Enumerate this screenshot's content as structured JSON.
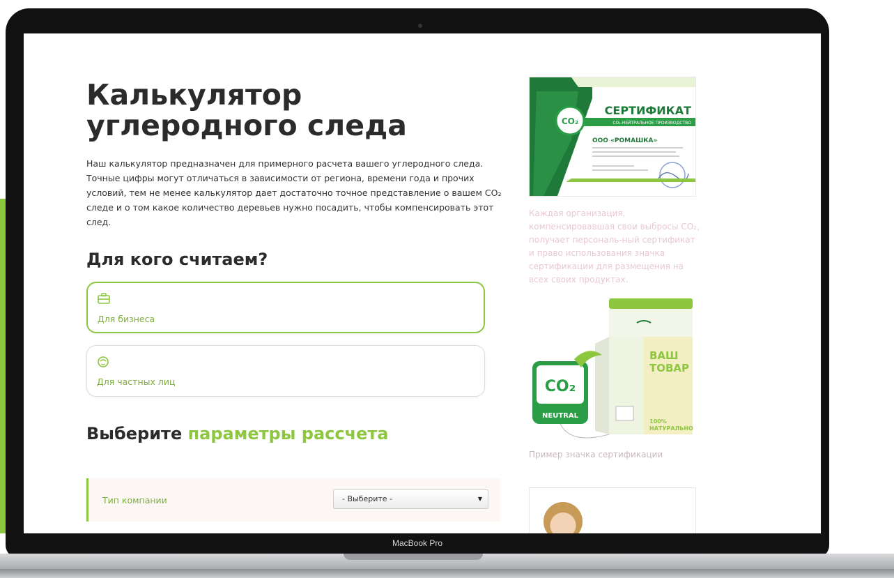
{
  "device": {
    "model_label": "MacBook Pro"
  },
  "page": {
    "title": "Калькулятор углеродного следа",
    "intro": "Наш калькулятор предназначен для примерного расчета вашего углеродного следа. Точные цифры могут отличаться в зависимости от региона, времени года и прочих условий, тем не менее калькулятор дает достаточно точное представление о вашем CO₂ следе и о том какое количество деревьев нужно посадить, чтобы компенсировать этот след.",
    "audience_heading": "Для кого считаем?",
    "audience_options": [
      {
        "label": "Для бизнеса",
        "icon": "briefcase-icon",
        "selected": true
      },
      {
        "label": "Для частных лиц",
        "icon": "person-icon",
        "selected": false
      }
    ],
    "params_heading_prefix": "Выберите ",
    "params_heading_accent": "параметры рассчета",
    "params": [
      {
        "label": "Тип компании",
        "select_value": "- Выберите -"
      }
    ]
  },
  "sidebar": {
    "certificate": {
      "title": "СЕРТИФИКАТ",
      "subtitle": "CO₂-НЕЙТРАЛЬНОЕ ПРОИЗВОДСТВО",
      "company": "ООО «РОМАШКА»",
      "badge": "CO₂"
    },
    "certificate_caption": "Каждая организация, компенсировавшая свои выбросы CO₂, получает персональ-ный сертификат и право использования значка сертификации для размещения на всех своих продуктах.",
    "product": {
      "badge_line1": "CO₂",
      "badge_line2": "NEUTRAL",
      "pack_line1": "ВАШ",
      "pack_line2": "ТОВАР",
      "pack_bottom1": "100%",
      "pack_bottom2": "НАТУРАЛЬНО"
    },
    "product_caption": "Пример значка сертификации"
  },
  "colors": {
    "accent": "#8dc63f",
    "label_green": "#7cae3c",
    "heading": "#2b2b2b"
  }
}
